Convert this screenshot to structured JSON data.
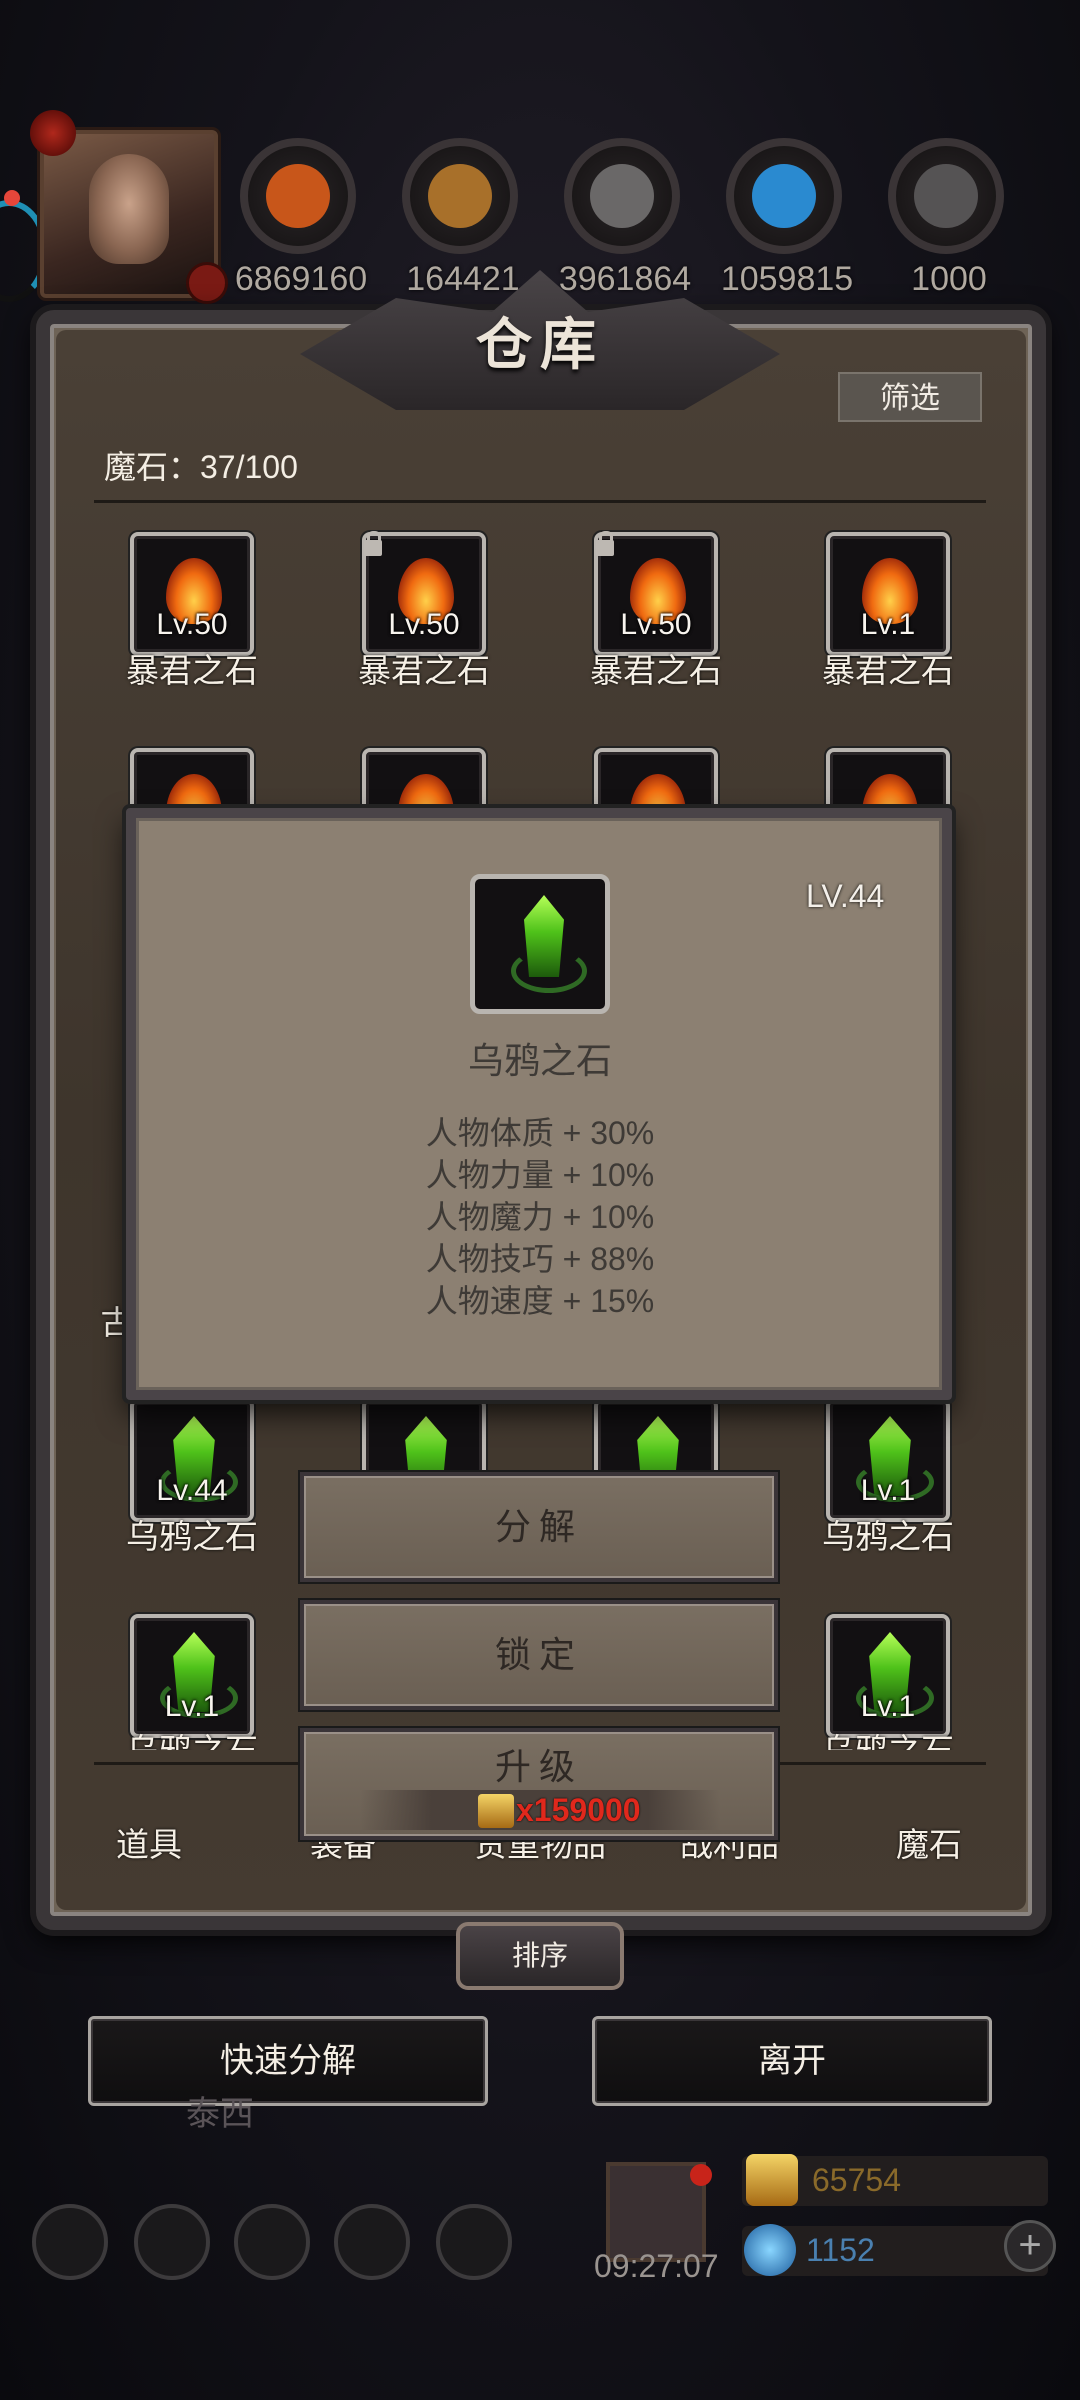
{
  "resources": [
    {
      "icon": "ore-orange-icon",
      "value": "6869160",
      "color": "#c8561a"
    },
    {
      "icon": "wood-plank-icon",
      "value": "164421",
      "color": "#a8702a"
    },
    {
      "icon": "iron-bar-icon",
      "value": "3961864",
      "color": "#6a6868"
    },
    {
      "icon": "crystal-blue-icon",
      "value": "1059815",
      "color": "#2a8ad0"
    },
    {
      "icon": "steel-block-icon",
      "value": "1000",
      "color": "#555354"
    }
  ],
  "warehouse": {
    "title": "仓库",
    "filter_label": "筛选",
    "count_label": "魔石：37/100",
    "slots_row1": [
      {
        "level": "Lv.50",
        "name": "暴君之石",
        "locked": false
      },
      {
        "level": "Lv.50",
        "name": "暴君之石",
        "locked": true
      },
      {
        "level": "Lv.50",
        "name": "暴君之石",
        "locked": true
      },
      {
        "level": "Lv.1",
        "name": "暴君之石",
        "locked": false
      }
    ],
    "slots_row_green": [
      {
        "level": "Lv.44",
        "name": "乌鸦之石"
      },
      {
        "level": "",
        "name": ""
      },
      {
        "level": "",
        "name": ""
      },
      {
        "level": "Lv.1",
        "name": "乌鸦之石"
      }
    ],
    "slots_row_last": [
      {
        "level": "Lv.1",
        "name": "乌鸦之石"
      },
      {
        "level": "Lv.1",
        "name": "乌鸦之石"
      }
    ],
    "partial_labels": [
      "石",
      "古"
    ],
    "tabs": [
      "道具",
      "装备",
      "贵重物品",
      "战利品",
      "魔石"
    ],
    "sort_label": "排序"
  },
  "popup": {
    "level": "LV.44",
    "name": "乌鸦之石",
    "stats": [
      "人物体质 + 30%",
      "人物力量 + 10%",
      "人物魔力 + 10%",
      "人物技巧 + 88%",
      "人物速度 + 15%"
    ],
    "actions": {
      "decompose": "分解",
      "lock": "锁定",
      "upgrade": "升级"
    },
    "upgrade_cost": "x159000"
  },
  "footer": {
    "quick_decompose": "快速分解",
    "leave": "离开",
    "faded_name": "泰西",
    "timer": "09:27:07",
    "gold": "65754",
    "gems": "1152",
    "plus": "+"
  },
  "colors": {
    "accent_gold": "#c9a24a",
    "cost_red": "#e0281c",
    "frame": "#3a3638"
  }
}
